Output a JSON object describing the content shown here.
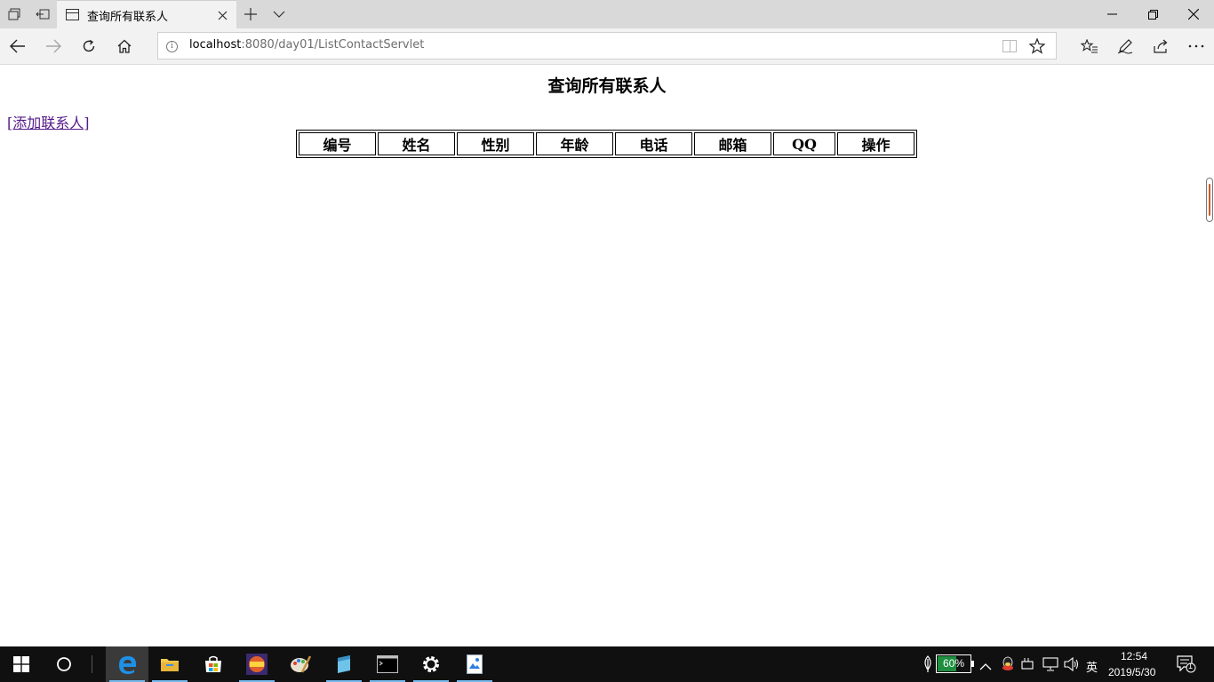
{
  "browser": {
    "tab_title": "查询所有联系人",
    "url_host": "localhost",
    "url_path": ":8080/day01/ListContactServlet"
  },
  "page": {
    "heading": "查询所有联系人",
    "add_link": "[添加联系人]",
    "table_headers": [
      "编号",
      "姓名",
      "性别",
      "年龄",
      "电话",
      "邮箱",
      "QQ",
      "操作"
    ]
  },
  "taskbar": {
    "battery_percent": 60,
    "battery_label": "60%",
    "ime": "英",
    "time": "12:54",
    "date": "2019/5/30",
    "notification_count": "1",
    "apps": [
      "edge-browser",
      "file-explorer",
      "microsoft-store",
      "media-app",
      "paint-app",
      "notepad-app",
      "command-prompt",
      "settings",
      "image-viewer"
    ]
  },
  "colors": {
    "link_visited": "#551a8b",
    "taskbar_bg": "#101010",
    "battery_fill": "#1e8f3e",
    "tab_active_bg": "#f2f2f2",
    "titlebar_bg": "#d9d9d9"
  }
}
